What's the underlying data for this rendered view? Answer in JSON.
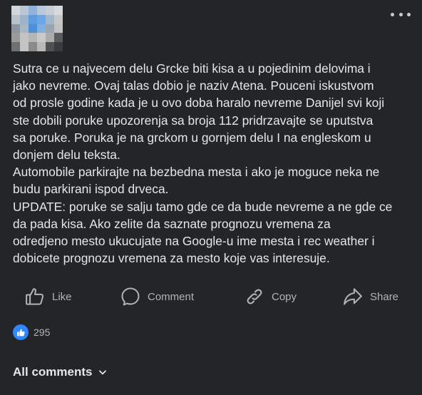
{
  "post": {
    "text": "Sutra ce u najvecem delu Grcke biti kisa a u pojedinim delovima i\njako nevreme. Ovaj talas dobio je naziv Atena. Pouceni iskustvom\nod prosle godine kada je u ovo doba haralo nevreme Danijel svi koji\nste dobili poruke upozorenja sa broja 112 pridrzavajte se uputstva\nsa poruke. Poruka je na grckom u gornjem delu I na engleskom u\ndonjem delu teksta.\nAutomobile parkirajte na bezbedna mesta i ako je moguce neka ne\nbudu parkirani ispod drveca.\nUPDATE: poruke se salju tamo gde ce da bude nevreme a ne gde ce\nda pada kisa. Ako zelite da saznate prognozu vremena za\nodredjeno mesto ukucujate na Google-u ime mesta i rec weather i\ndobicete prognozu vremena za mesto koje vas interesuje."
  },
  "actions": {
    "like": "Like",
    "comment": "Comment",
    "copy": "Copy",
    "share": "Share"
  },
  "reactions": {
    "count": "295"
  },
  "comments": {
    "toggle_label": "All comments"
  },
  "icons": {
    "more": "more-options-icon",
    "like": "thumbs-up-icon",
    "comment": "comment-bubble-icon",
    "copy": "link-icon",
    "share": "share-arrow-icon",
    "chevron": "chevron-down-icon"
  },
  "colors": {
    "background": "#242526",
    "text": "#e4e6eb",
    "secondary_text": "#b0b3b8",
    "like_blue": "#2d88ff"
  }
}
